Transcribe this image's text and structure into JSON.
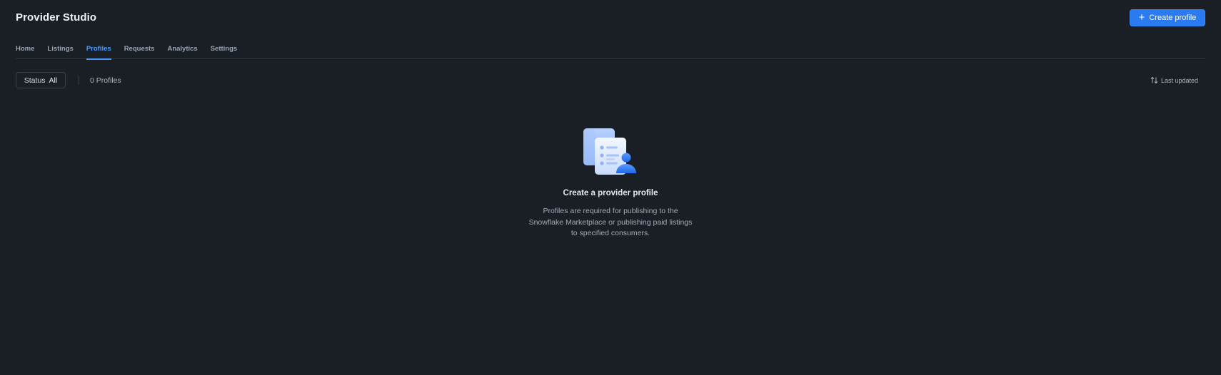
{
  "header": {
    "title": "Provider Studio",
    "create_label": "Create profile"
  },
  "tabs": [
    {
      "label": "Home"
    },
    {
      "label": "Listings"
    },
    {
      "label": "Profiles",
      "active": true
    },
    {
      "label": "Requests"
    },
    {
      "label": "Analytics"
    },
    {
      "label": "Settings"
    }
  ],
  "toolbar": {
    "status_label": "Status",
    "status_value": "All",
    "count_text": "0 Profiles",
    "sort_label": "Last updated"
  },
  "empty_state": {
    "icon": "profile-document-illustration",
    "title": "Create a provider profile",
    "description": "Profiles are required for publishing to the Snowflake Marketplace or publishing paid listings to specified consumers."
  },
  "colors": {
    "background": "#1a1e25",
    "accent": "#2b7bf0",
    "active_tab": "#4c9bff"
  }
}
